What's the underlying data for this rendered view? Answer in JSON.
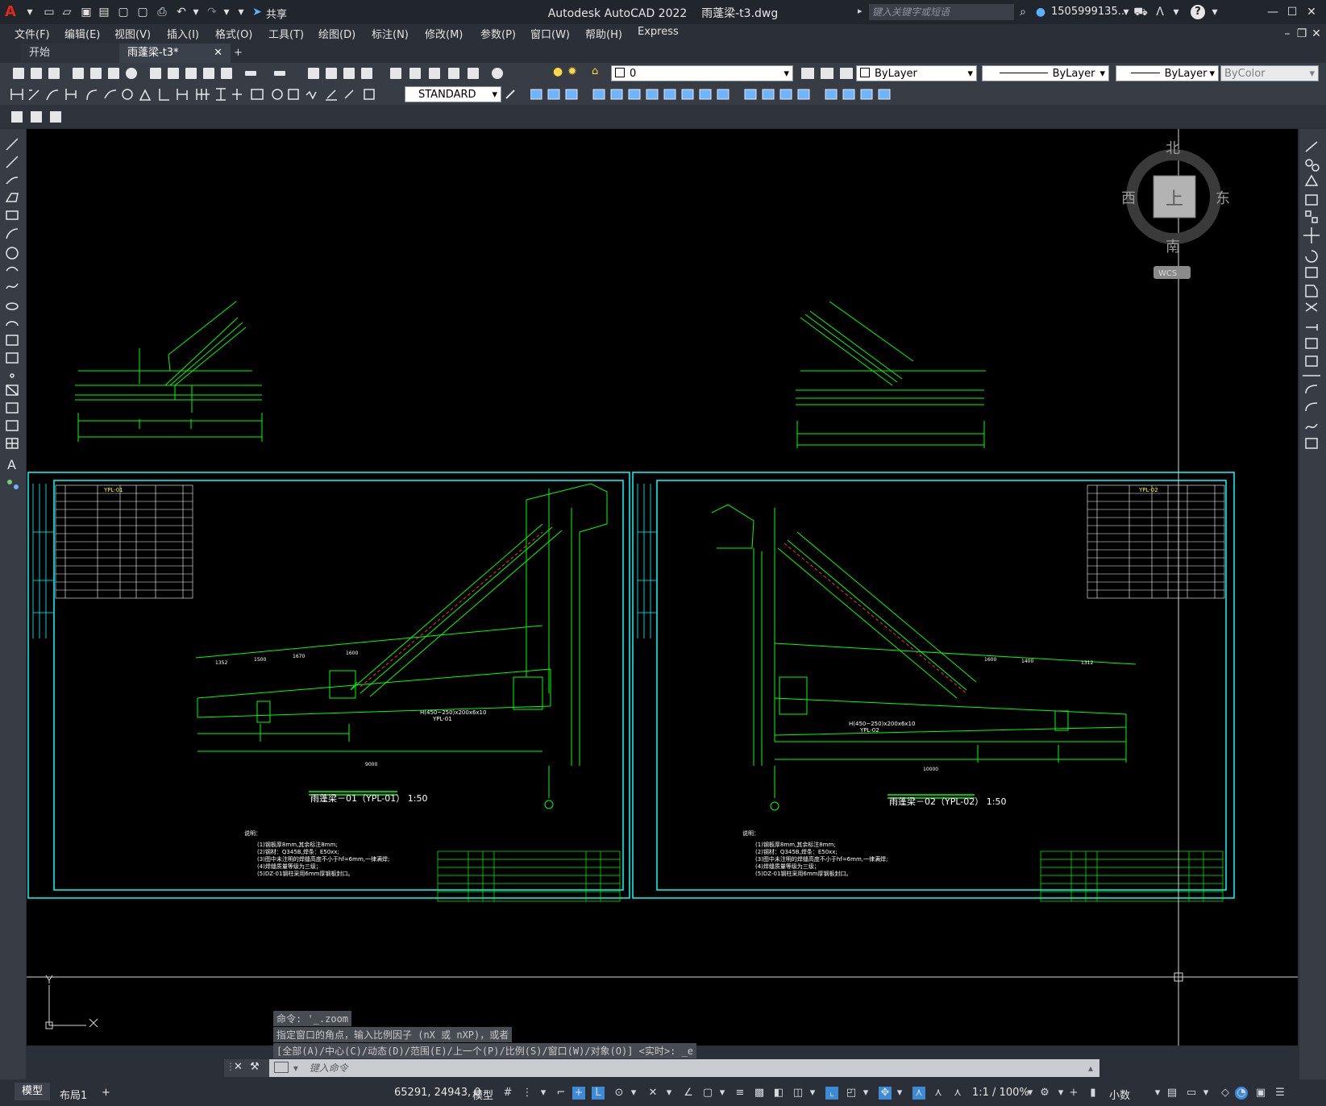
{
  "window": {
    "app_title": "Autodesk AutoCAD 2022",
    "file_title": "雨蓬梁-t3.dwg",
    "share_label": "共享",
    "search_placeholder": "键入关键字或短语",
    "user": "1505999135...",
    "help_label": "?"
  },
  "menu": [
    "文件(F)",
    "编辑(E)",
    "视图(V)",
    "插入(I)",
    "格式(O)",
    "工具(T)",
    "绘图(D)",
    "标注(N)",
    "修改(M)",
    "参数(P)",
    "窗口(W)",
    "帮助(H)",
    "Express"
  ],
  "tabs": [
    {
      "label": "开始"
    },
    {
      "label": "雨蓬梁-t3*"
    }
  ],
  "toolbar": {
    "layer_value": "0",
    "color_value": "ByLayer",
    "linetype_value": "ByLayer",
    "lineweight_value": "ByLayer",
    "plotstyle_value": "ByColor",
    "dimstyle_value": "STANDARD"
  },
  "viewcube": {
    "north": "北",
    "south": "南",
    "east": "东",
    "west": "西",
    "face": "上",
    "wcs": "WCS"
  },
  "drawing": {
    "title_left": "雨蓬梁－01（YPL-01） 1:50",
    "title_right": "雨蓬梁－02（YPL-02） 1:50",
    "beam_left": "H(450~250)x200x6x10",
    "beam_left_tag": "YPL-01",
    "beam_right": "H(450~250)x200x6x10",
    "beam_right_tag": "YPL-02",
    "notes_title": "说明：",
    "notes": [
      "(1)钢板厚8mm,其余标注8mm;",
      "(2)钢材：Q345B,焊条：E50xx;",
      "(3)图中未注明的焊缝高度不小于hf=6mm,一律满焊;",
      "(4)焊缝质量等级为三级；",
      "(5)DZ-01钢柱采用6mm厚钢板封口。"
    ],
    "table_title_left": "YPL-01",
    "table_title_right": "YPL-02",
    "overall_dim_left": "9000",
    "overall_dim_right": "10000",
    "top_dims_left": [
      "1352",
      "1500",
      "1670",
      "1600"
    ],
    "top_dims_right": [
      "1600",
      "1400",
      "1312"
    ]
  },
  "command": {
    "history": [
      "命令: '_.zoom",
      "指定窗口的角点，输入比例因子 (nX 或 nXP)，或者",
      "[全部(A)/中心(C)/动态(D)/范围(E)/上一个(P)/比例(S)/窗口(W)/对象(O)] <实时>: _e"
    ],
    "placeholder": "键入命令"
  },
  "layout_tabs": [
    "模型",
    "布局1"
  ],
  "status": {
    "coords": "65291, 24943, 0",
    "model": "模型",
    "scale": "1:1 / 100%",
    "units": "小数"
  },
  "colors": {
    "canvas": "#000000",
    "drawing_green": "#00ff00",
    "frame_cyan": "#00ffff",
    "accent_blue": "#3d8bd6"
  }
}
